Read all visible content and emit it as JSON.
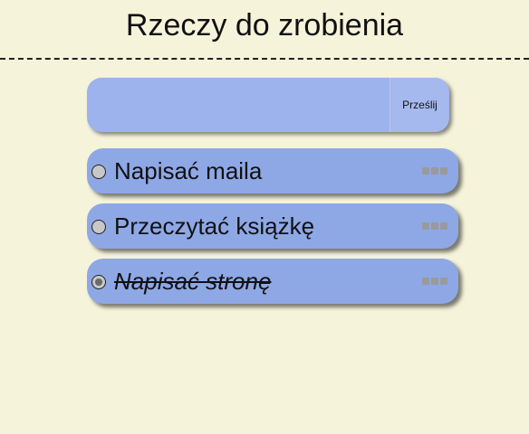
{
  "header": {
    "title": "Rzeczy do zrobienia"
  },
  "form": {
    "input_value": "",
    "submit_label": "Prześlij"
  },
  "tasks": [
    {
      "label": "Napisać maila",
      "done": false
    },
    {
      "label": "Przeczytać książkę",
      "done": false
    },
    {
      "label": "Napisać stronę",
      "done": true
    }
  ],
  "icons": {
    "more": "more-dots-icon",
    "radio": "radio-icon"
  },
  "colors": {
    "background": "#f5f3da",
    "item": "#8ea8e6",
    "input": "#9db3ee"
  }
}
